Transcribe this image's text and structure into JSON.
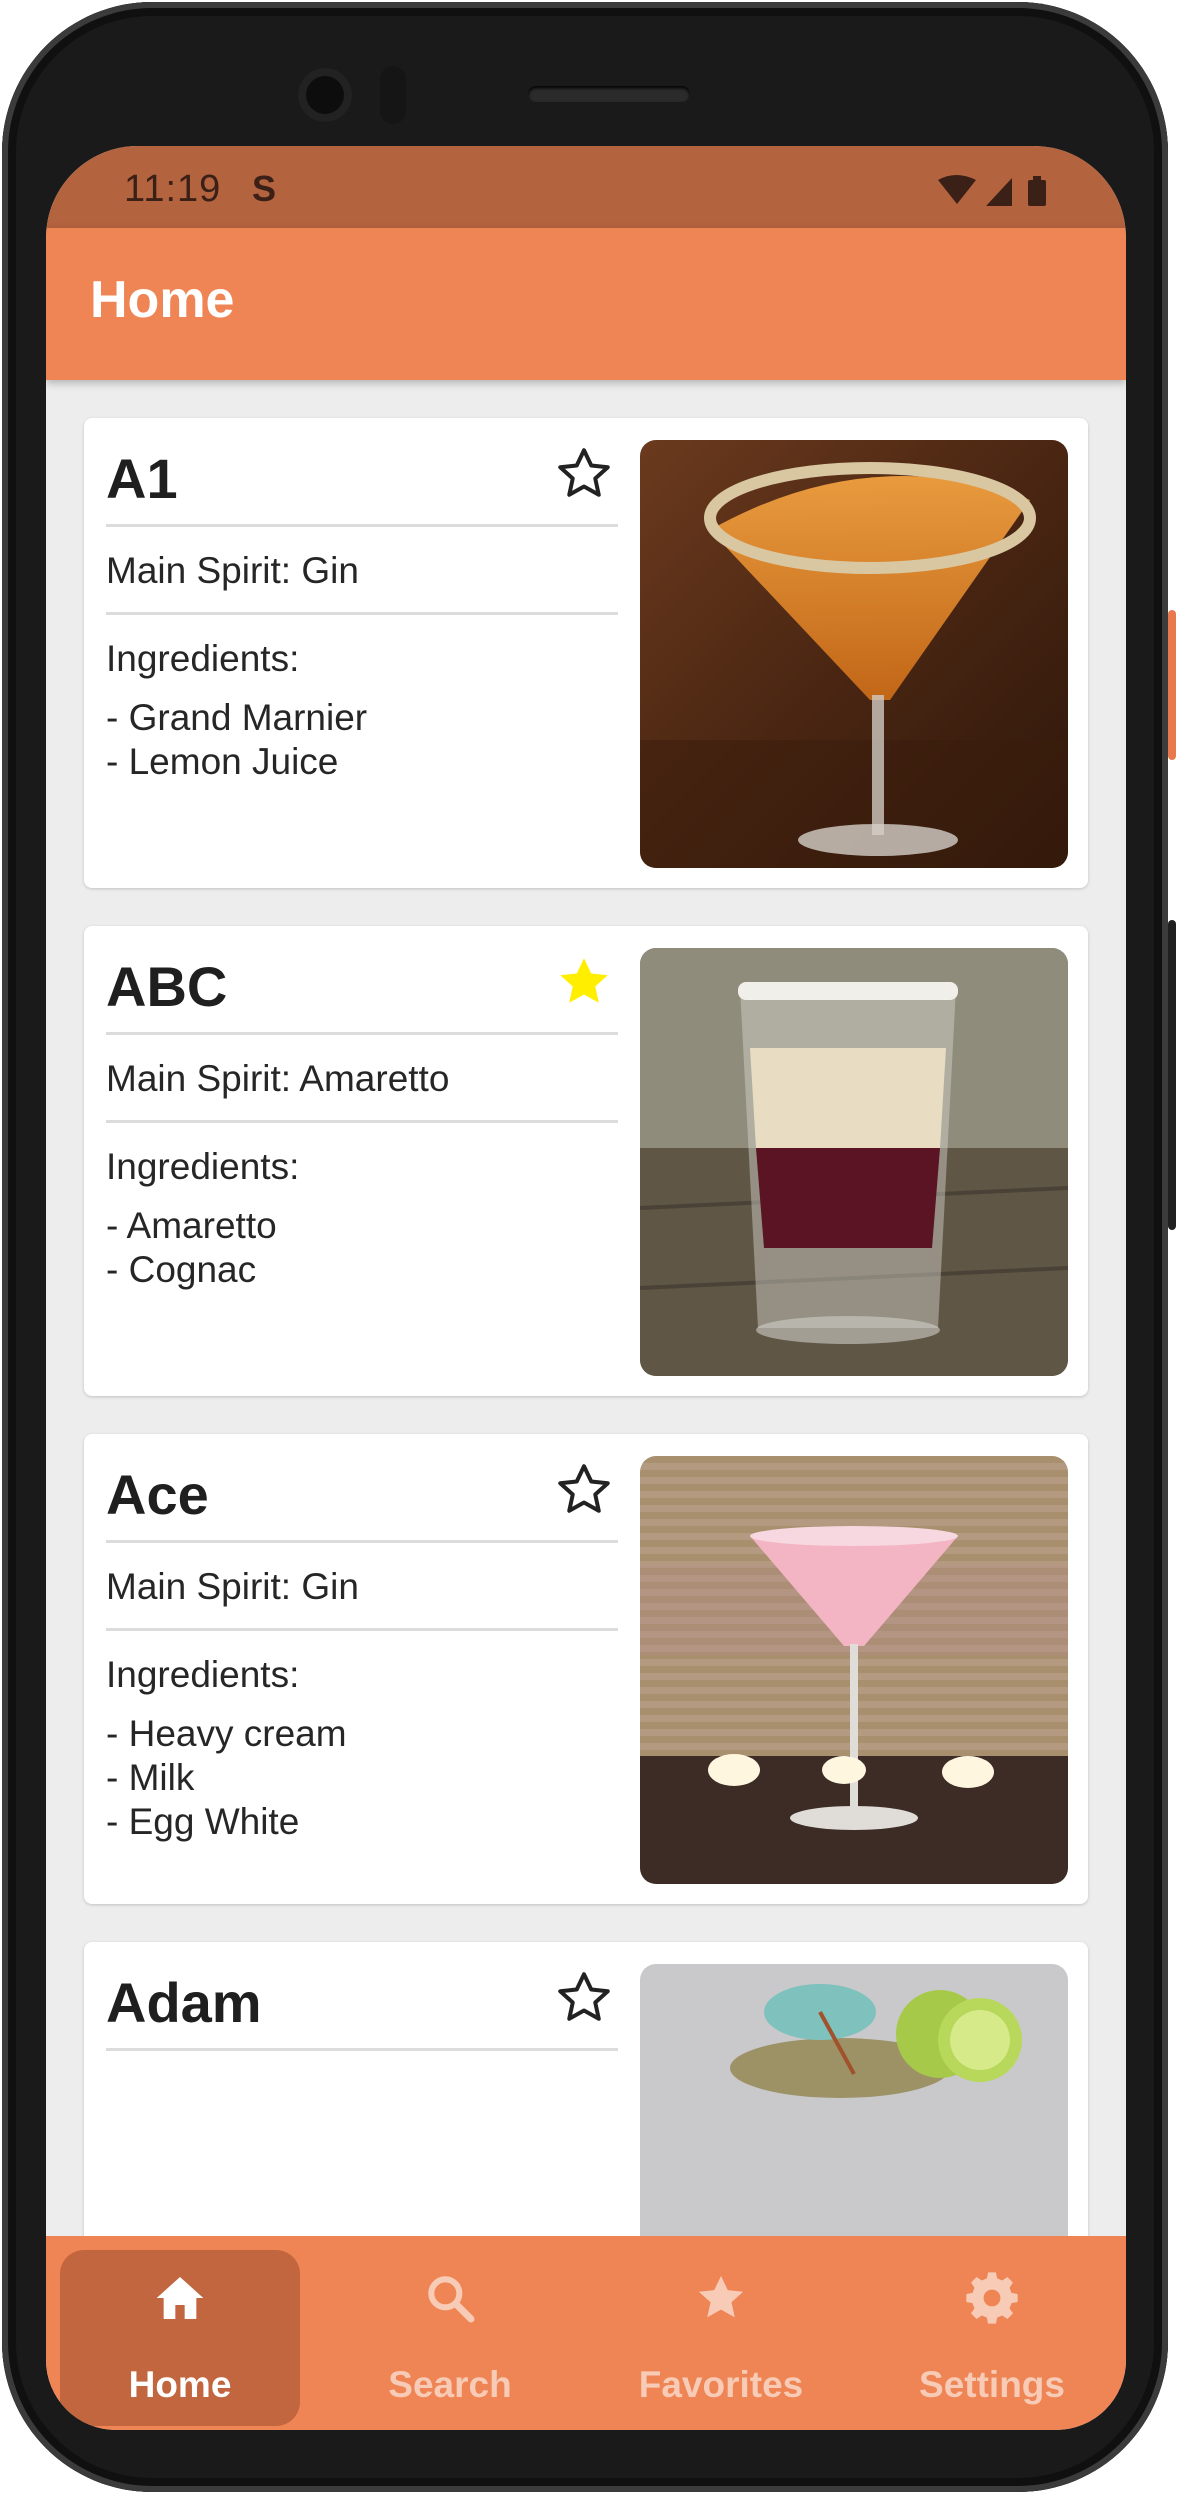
{
  "status_bar": {
    "time": "11:19",
    "notification_glyph": "S",
    "icons": [
      "wifi-icon",
      "signal-icon",
      "battery-icon"
    ]
  },
  "app_bar": {
    "title": "Home"
  },
  "colors": {
    "app_bar": "#ef8455",
    "status_bar": "#b4633f",
    "active_nav": "#c1663f",
    "favorite_star": "#ffee00"
  },
  "cocktails": [
    {
      "name": "A1",
      "main_spirit": "Main Spirit: Gin",
      "ingredients_label": "Ingredients:",
      "ingredients": [
        "- Grand Marnier",
        "- Lemon Juice"
      ],
      "favorite": false,
      "image": "orange martini with sugared rim"
    },
    {
      "name": "ABC",
      "main_spirit": "Main Spirit: Amaretto",
      "ingredients_label": "Ingredients:",
      "ingredients": [
        "- Amaretto",
        "- Cognac"
      ],
      "favorite": true,
      "image": "layered shot glass"
    },
    {
      "name": "Ace",
      "main_spirit": "Main Spirit: Gin",
      "ingredients_label": "Ingredients:",
      "ingredients": [
        "- Heavy cream",
        "- Milk",
        "- Egg White"
      ],
      "favorite": false,
      "image": "pink martini with candles"
    },
    {
      "name": "Adam",
      "favorite": false,
      "image": "cocktail with lime slices and umbrella"
    }
  ],
  "bottom_nav": [
    {
      "label": "Home",
      "icon": "home-icon",
      "active": true
    },
    {
      "label": "Search",
      "icon": "search-icon",
      "active": false
    },
    {
      "label": "Favorites",
      "icon": "star-icon",
      "active": false
    },
    {
      "label": "Settings",
      "icon": "gear-icon",
      "active": false
    }
  ],
  "system_nav": [
    "back-icon",
    "home-circle-icon",
    "recents-icon"
  ]
}
